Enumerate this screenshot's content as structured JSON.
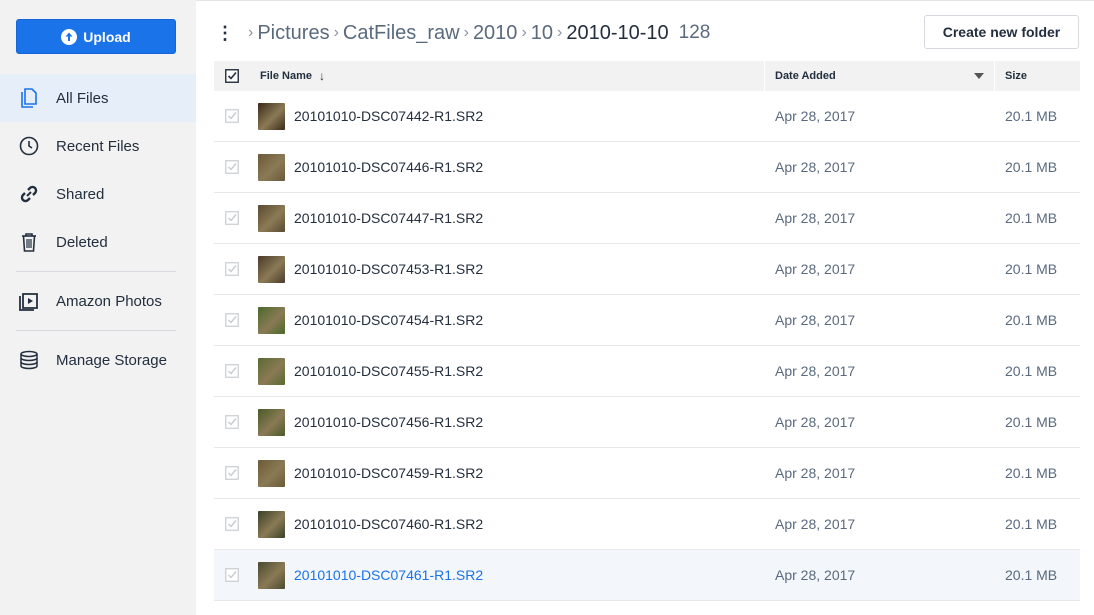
{
  "sidebar": {
    "upload_label": "Upload",
    "items": [
      {
        "label": "All Files",
        "icon": "all-files-icon",
        "active": true
      },
      {
        "label": "Recent Files",
        "icon": "clock-icon"
      },
      {
        "label": "Shared",
        "icon": "link-icon"
      },
      {
        "label": "Deleted",
        "icon": "trash-icon"
      },
      {
        "label": "Amazon Photos",
        "icon": "photos-icon"
      },
      {
        "label": "Manage Storage",
        "icon": "database-icon"
      }
    ]
  },
  "breadcrumb": {
    "items": [
      "Pictures",
      "CatFiles_raw",
      "2010",
      "10"
    ],
    "current": "2010-10-10",
    "count": "128"
  },
  "toolbar": {
    "new_folder_label": "Create new folder"
  },
  "table": {
    "headers": {
      "name": "File Name",
      "date": "Date Added",
      "size": "Size"
    },
    "rows": [
      {
        "name": "20101010-DSC07442-R1.SR2",
        "date": "Apr 28, 2017",
        "size": "20.1 MB",
        "thumb": "#3a2a1a"
      },
      {
        "name": "20101010-DSC07446-R1.SR2",
        "date": "Apr 28, 2017",
        "size": "20.1 MB",
        "thumb": "#6b5a3a"
      },
      {
        "name": "20101010-DSC07447-R1.SR2",
        "date": "Apr 28, 2017",
        "size": "20.1 MB",
        "thumb": "#5a4a30"
      },
      {
        "name": "20101010-DSC07453-R1.SR2",
        "date": "Apr 28, 2017",
        "size": "20.1 MB",
        "thumb": "#4a3a2a"
      },
      {
        "name": "20101010-DSC07454-R1.SR2",
        "date": "Apr 28, 2017",
        "size": "20.1 MB",
        "thumb": "#4a6a2a"
      },
      {
        "name": "20101010-DSC07455-R1.SR2",
        "date": "Apr 28, 2017",
        "size": "20.1 MB",
        "thumb": "#5a6a30"
      },
      {
        "name": "20101010-DSC07456-R1.SR2",
        "date": "Apr 28, 2017",
        "size": "20.1 MB",
        "thumb": "#4a5a28"
      },
      {
        "name": "20101010-DSC07459-R1.SR2",
        "date": "Apr 28, 2017",
        "size": "20.1 MB",
        "thumb": "#6a5a35"
      },
      {
        "name": "20101010-DSC07460-R1.SR2",
        "date": "Apr 28, 2017",
        "size": "20.1 MB",
        "thumb": "#3a4028"
      },
      {
        "name": "20101010-DSC07461-R1.SR2",
        "date": "Apr 28, 2017",
        "size": "20.1 MB",
        "thumb": "#4a4a30",
        "highlighted": true
      }
    ]
  },
  "colors": {
    "accent": "#1a73e8",
    "sidebar_bg": "#f2f2f2",
    "active_item_bg": "#e6eef9"
  }
}
